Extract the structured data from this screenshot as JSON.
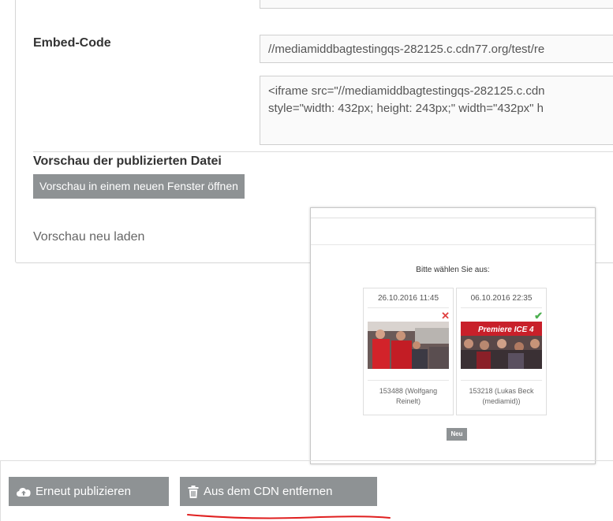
{
  "embed": {
    "label": "Embed-Code",
    "url_value": "//mediamiddbagtestingqs-282125.c.cdn77.org/test/re",
    "code_line1": "<iframe src=\"//mediamiddbagtestingqs-282125.c.cdn",
    "code_line2": "style=\"width: 432px; height: 243px;\" width=\"432px\" h"
  },
  "preview": {
    "title": "Vorschau der publizierten Datei",
    "open_button": "Vorschau in einem neuen Fenster öffnen",
    "reload_link": "Vorschau neu laden"
  },
  "modal": {
    "prompt": "Bitte wählen Sie aus:",
    "cards": [
      {
        "date": "26.10.2016 11:45",
        "caption_line1": "153488 (Wolfgang",
        "caption_line2": "Reinelt)",
        "mark": "✕",
        "mark_color": "#e04040",
        "status_icon": "close-icon"
      },
      {
        "date": "06.10.2016 22:35",
        "caption_line1": "153218 (Lukas Beck",
        "caption_line2": "(mediamid))",
        "mark": "✔",
        "mark_color": "#4caf50",
        "status_icon": "check-icon",
        "photo_text": "Premiere ICE 4"
      }
    ],
    "new_button": "Neu"
  },
  "footer": {
    "republish_button": "Erneut publizieren",
    "remove_button": "Aus dem CDN entfernen",
    "republish_icon": "cloud-upload-icon",
    "remove_icon": "trash-icon"
  },
  "colors": {
    "button_grey": "#8e9294",
    "annotation_red": "#e02020"
  }
}
